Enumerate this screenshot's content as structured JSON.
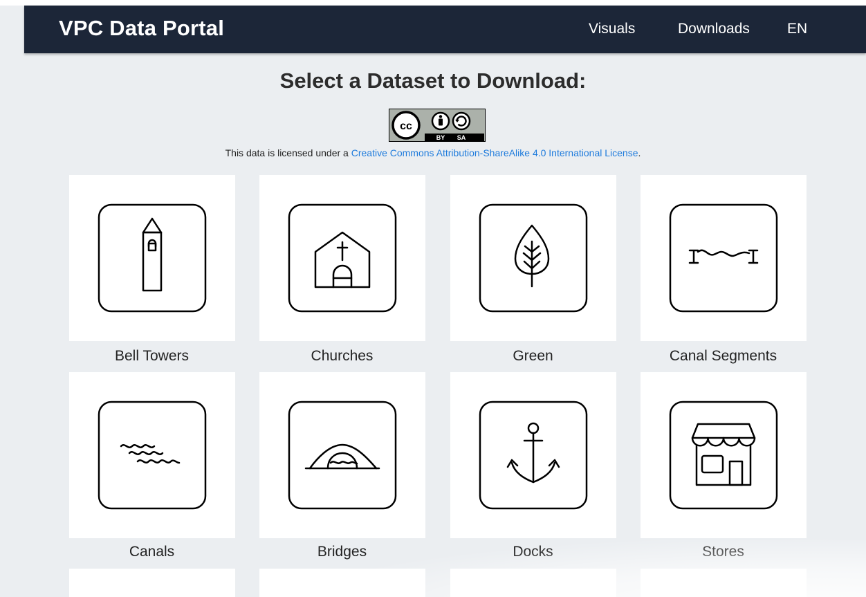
{
  "header": {
    "brand": "VPC Data Portal",
    "nav": [
      "Visuals",
      "Downloads",
      "EN"
    ]
  },
  "main": {
    "title": "Select a Dataset to Download:",
    "license_prefix": "This data is licensed under a ",
    "license_link": "Creative Commons Attribution-ShareAlike 4.0 International License",
    "license_suffix": ".",
    "badge": {
      "by": "BY",
      "sa": "SA"
    },
    "datasets": [
      {
        "label": "Bell Towers",
        "icon": "bell-tower-icon"
      },
      {
        "label": "Churches",
        "icon": "church-icon"
      },
      {
        "label": "Green",
        "icon": "leaf-icon"
      },
      {
        "label": "Canal Segments",
        "icon": "canal-segment-icon"
      },
      {
        "label": "Canals",
        "icon": "waves-icon"
      },
      {
        "label": "Bridges",
        "icon": "bridge-icon"
      },
      {
        "label": "Docks",
        "icon": "anchor-icon"
      },
      {
        "label": "Stores",
        "icon": "store-icon"
      }
    ]
  },
  "colors": {
    "navbar": "#1c2638",
    "background": "#ebeef1",
    "link": "#1e7bdc"
  }
}
